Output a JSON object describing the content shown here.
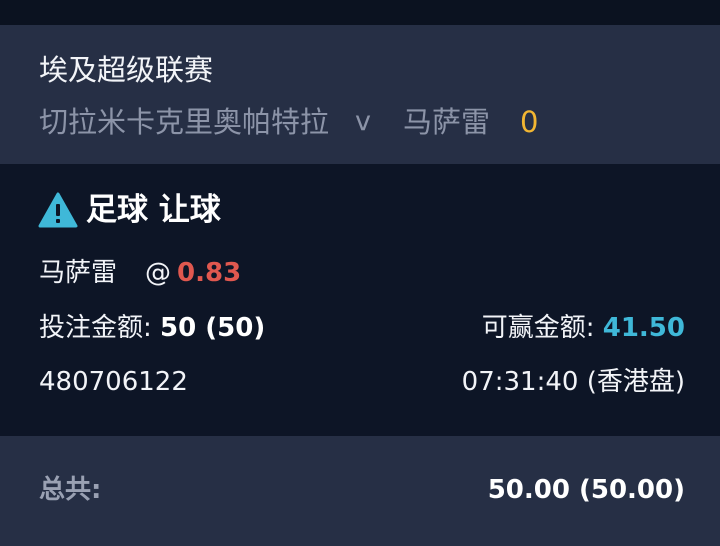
{
  "match": {
    "league": "埃及超级联赛",
    "home_team": "切拉米卡克里奥帕特拉",
    "vs": "v",
    "away_team": "马萨雷",
    "score": "0"
  },
  "market": {
    "title": "足球 让球",
    "icon": "warning-icon"
  },
  "selection": {
    "name": "马萨雷",
    "at": "@",
    "odds": "0.83"
  },
  "stake": {
    "label": "投注金额:",
    "value": "50 (50)"
  },
  "win": {
    "label": "可赢金额:",
    "value": "41.50"
  },
  "bet_id": "480706122",
  "time": "07:31:40 (香港盘)",
  "total": {
    "label": "总共:",
    "value": "50.00 (50.00)"
  },
  "colors": {
    "header_bg": "#262f45",
    "body_bg": "#0d1526",
    "odds": "#e0584f",
    "win": "#3fb8d8",
    "score": "#f2b632",
    "warning": "#3fb8d8"
  }
}
